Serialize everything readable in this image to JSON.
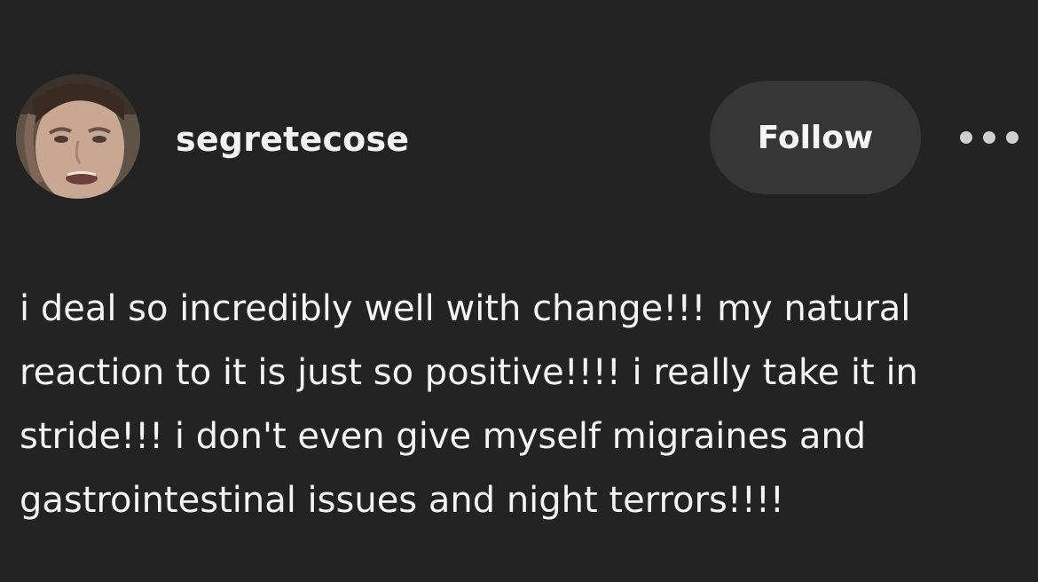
{
  "post": {
    "username": "segretecose",
    "follow_label": "Follow",
    "more_icon": "more-horizontal-icon",
    "body": "i deal so incredibly well with change!!! my natural\nreaction to it is just so positive!!!! i really take it in\nstride!!! i don't even give myself migraines and\ngastrointestinal issues and night terrors!!!!"
  },
  "theme": {
    "background": "#232323",
    "button_background": "#363636",
    "text": "#f4f4f4"
  }
}
